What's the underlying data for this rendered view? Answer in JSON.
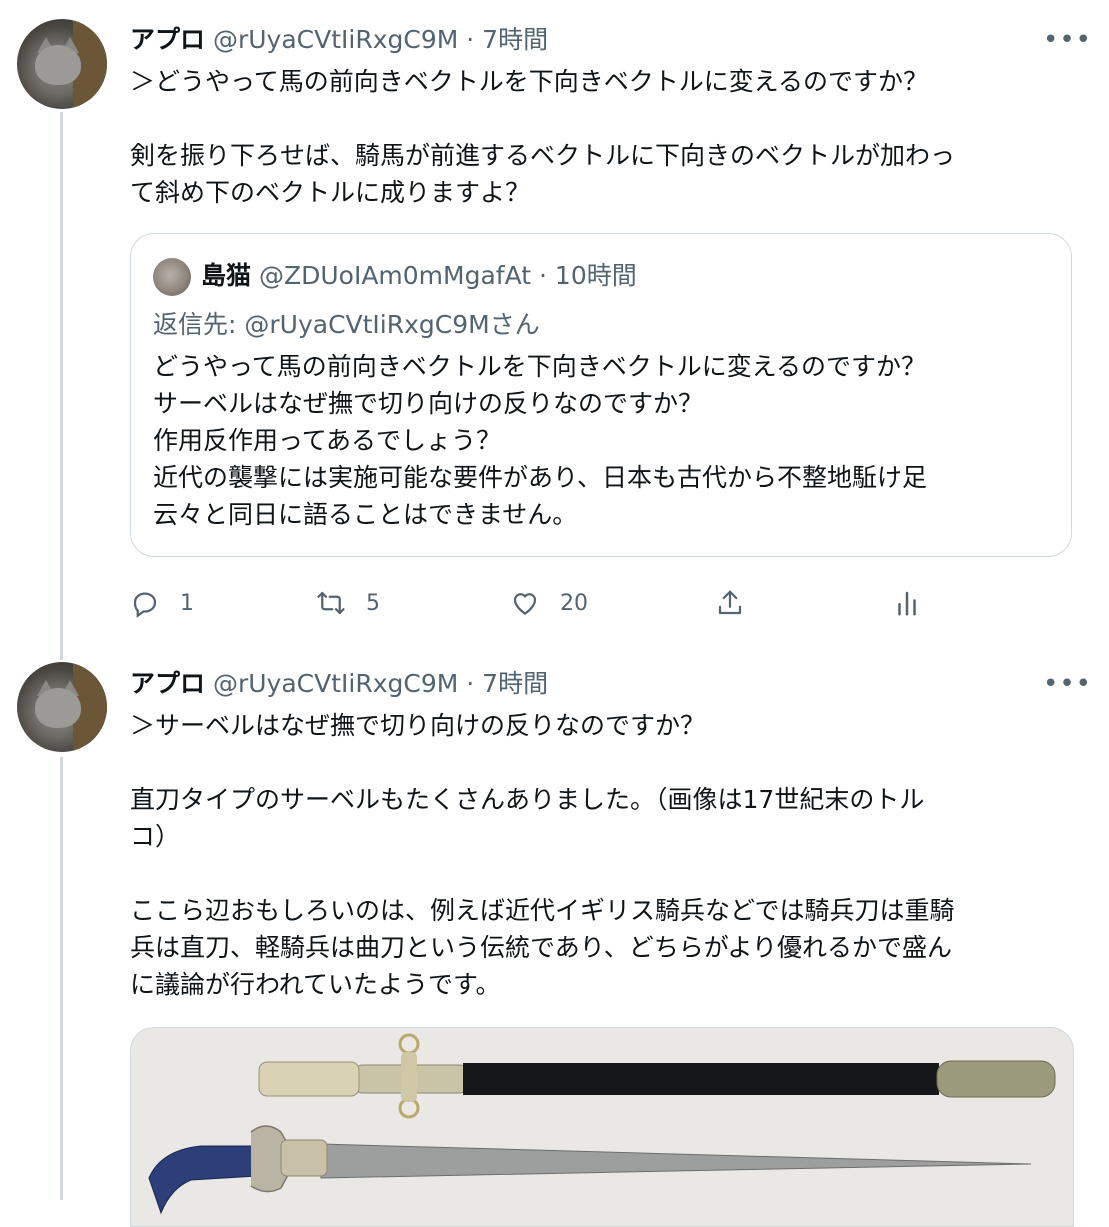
{
  "tweets": [
    {
      "author_name": "アプロ",
      "author_handle": "@rUyaCVtIiRxgC9M",
      "time": "· 7時間",
      "lines": [
        "＞どうやって馬の前向きベクトルを下向きベクトルに変えるのですか？",
        "",
        "剣を振り下ろせば、騎馬が前進するベクトルに下向きのベクトルが加わっ",
        "て斜め下のベクトルに成りますよ？"
      ],
      "quote": {
        "author_name": "島猫",
        "author_handle": "@ZDUoIAm0mMgafAt",
        "time": "· 10時間",
        "reply_prefix": "返信先: ",
        "reply_to": "@rUyaCVtIiRxgC9Mさん",
        "lines": [
          "どうやって馬の前向きベクトルを下向きベクトルに変えるのですか？",
          "サーベルはなぜ撫で切り向けの反りなのですか？",
          "作用反作用ってあるでしょう？",
          "近代の襲撃には実施可能な要件があり、日本も古代から不整地駈け足",
          "云々と同日に語ることはできません。"
        ]
      },
      "actions": {
        "replies": "1",
        "retweets": "5",
        "likes": "20"
      }
    },
    {
      "author_name": "アプロ",
      "author_handle": "@rUyaCVtIiRxgC9M",
      "time": "· 7時間",
      "lines": [
        "＞サーベルはなぜ撫で切り向けの反りなのですか？",
        "",
        "直刀タイプのサーベルもたくさんありました。（画像は17世紀末のトル",
        "コ）",
        "",
        "ここら辺おもしろいのは、例えば近代イギリス騎兵などでは騎兵刀は重騎",
        "兵は直刀、軽騎兵は曲刀という伝統であり、どちらがより優れるかで盛ん",
        "に議論が行われていたようです。"
      ]
    }
  ],
  "icons": {
    "more": "more-icon",
    "reply": "reply-icon",
    "retweet": "retweet-icon",
    "like": "like-icon",
    "share": "share-icon",
    "analytics": "analytics-icon"
  },
  "colors": {
    "text": "#0f1419",
    "secondary": "#536471",
    "border": "#cfd9de"
  }
}
